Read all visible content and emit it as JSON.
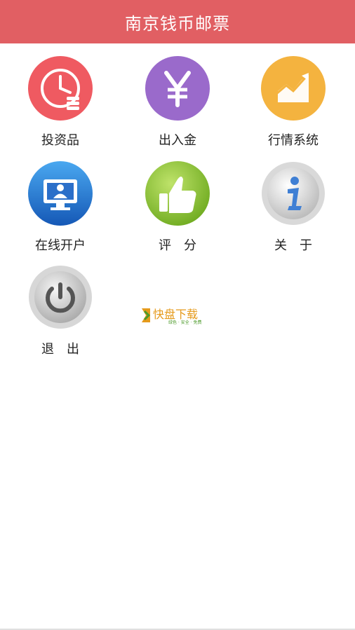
{
  "header": {
    "title": "南京钱币邮票",
    "color": "#e15f63"
  },
  "menu": [
    {
      "label": "投资品",
      "icon": "clock-icon",
      "color": "#ef5a61"
    },
    {
      "label": "出入金",
      "icon": "yen-icon",
      "color": "#9a6acb"
    },
    {
      "label": "行情系统",
      "icon": "chart-icon",
      "color": "#f4b33f"
    },
    {
      "label": "在线开户",
      "icon": "monitor-user-icon",
      "color": "#2b6fc9"
    },
    {
      "label": "评　分",
      "icon": "thumbs-up-icon",
      "color": "#8fc53a"
    },
    {
      "label": "关　于",
      "icon": "info-icon",
      "color": "#c9c9c9"
    },
    {
      "label": "退　出",
      "icon": "power-icon",
      "color": "#bdbdbd"
    }
  ],
  "watermark": {
    "text": "快盘下载",
    "subtext": "绿色 · 安全 · 免费"
  }
}
